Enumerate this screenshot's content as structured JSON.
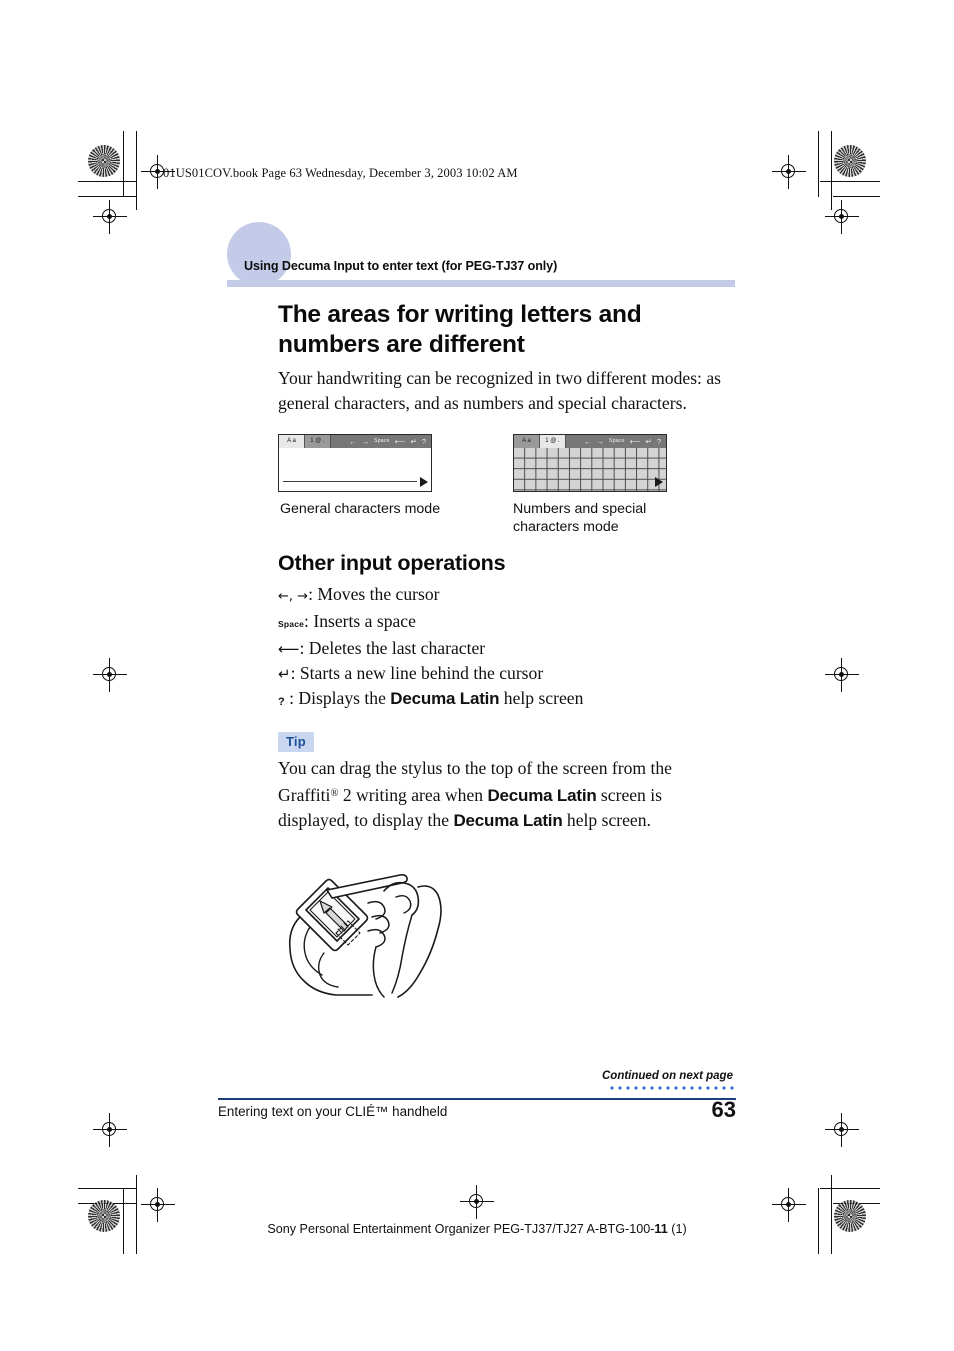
{
  "print_header": "01US01COV.book  Page 63  Wednesday, December 3, 2003  10:02 AM",
  "running_head": "Using Decuma Input to enter text (for PEG-TJ37 only)",
  "colors": {
    "runhead_band": "#c3cbe8",
    "tip_badge_bg": "#c9d6ef",
    "tip_badge_text": "#1b4e9b",
    "footer_rule": "#1b3f77",
    "dots": "#2f6fd0"
  },
  "section1": {
    "heading": "The areas for writing letters and numbers are different",
    "body": "Your handwriting can be recognized in two different modes: as general characters, and as numbers and special characters."
  },
  "screens": {
    "general": {
      "caption": "General characters mode",
      "tab_active": "A a",
      "tab_inactive": "1 @ .",
      "toolbar_icons": [
        "←",
        "→",
        "Space",
        "⟵",
        "↵",
        "?"
      ]
    },
    "numbers": {
      "caption": "Numbers and special characters mode",
      "tab_active": "1 @ .",
      "tab_inactive": "A a",
      "toolbar_icons": [
        "←",
        "→",
        "Space",
        "⟵",
        "↵",
        "?"
      ]
    }
  },
  "section2": {
    "heading": "Other input operations",
    "operations": [
      {
        "symbol": "←, →",
        "text": ": Moves the cursor"
      },
      {
        "symbol": "Space",
        "text": ": Inserts a space"
      },
      {
        "symbol": "⟵",
        "text": ": Deletes the last character"
      },
      {
        "symbol": "↵",
        "text": ": Starts a new line behind the cursor"
      },
      {
        "symbol": "?",
        "text_before": " : Displays the ",
        "bold": "Decuma Latin",
        "text_after": " help screen"
      }
    ]
  },
  "tip": {
    "badge": "Tip",
    "line1_a": "You can drag the stylus to the top of the screen from the Graffiti",
    "line1_reg": "®",
    "line1_b": " 2 writing area when ",
    "bold1": "Decuma Latin",
    "line2": " screen is displayed, to display the ",
    "bold2": "Decuma Latin",
    "line3": " help screen."
  },
  "illustration": {
    "alt": "Hand holding a CLIE handheld while dragging the stylus upward on the screen"
  },
  "footer": {
    "continued": "Continued on next page",
    "chapter": "Entering text on your CLIÉ™ handheld",
    "page_number": "63",
    "imprint_a": "Sony Personal Entertainment Organizer  PEG-TJ37/TJ27  A-BTG-100-",
    "imprint_b": "11",
    "imprint_c": " (1)"
  }
}
